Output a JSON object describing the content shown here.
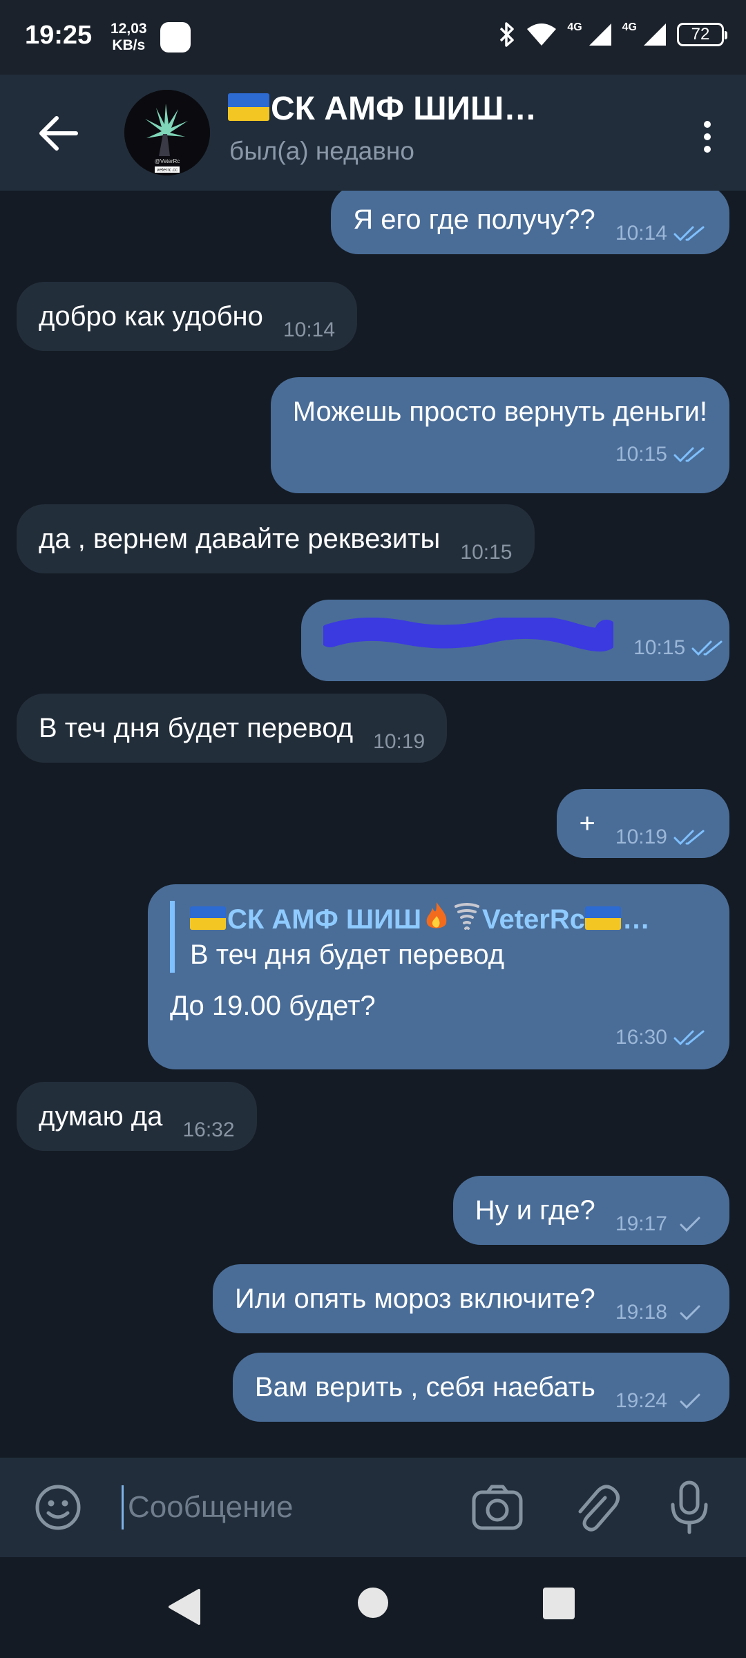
{
  "status_bar": {
    "time": "19:25",
    "speed_value": "12,03",
    "speed_unit": "KB/s",
    "network_1": "4G",
    "network_2": "4G",
    "battery": "72"
  },
  "header": {
    "title": "СК АМФ ШИШ…",
    "subtitle": "был(а) недавно",
    "avatar_caption_1": "@VeterRc",
    "avatar_caption_2": "veterrc.cc"
  },
  "messages": [
    {
      "dir": "out",
      "text": "Я его где получу??",
      "time": "10:14",
      "status": "read"
    },
    {
      "dir": "in",
      "text": "добро как удобно",
      "time": "10:14"
    },
    {
      "dir": "out",
      "text": "Можешь просто вернуть деньги!",
      "time": "10:15",
      "status": "read"
    },
    {
      "dir": "in",
      "text": "да  , вернем давайте реквезиты",
      "time": "10:15"
    },
    {
      "dir": "out",
      "text": "",
      "time": "10:15",
      "status": "read",
      "redacted": true
    },
    {
      "dir": "in",
      "text": "В теч дня будет перевод",
      "time": "10:19"
    },
    {
      "dir": "out",
      "text": "+",
      "time": "10:19",
      "status": "read"
    },
    {
      "dir": "out",
      "text": "До 19.00 будет?",
      "time": "16:30",
      "status": "read",
      "reply_name": "СК АМФ ШИШ",
      "reply_name_2": "VeterRc",
      "reply_text": "В теч дня будет перевод"
    },
    {
      "dir": "in",
      "text": "думаю да",
      "time": "16:32"
    },
    {
      "dir": "out",
      "text": "Ну и где?",
      "time": "19:17",
      "status": "sent"
    },
    {
      "dir": "out",
      "text": "Или опять мороз включите?",
      "time": "19:18",
      "status": "sent"
    },
    {
      "dir": "out",
      "text": "Вам верить , себя наебать",
      "time": "19:24",
      "status": "sent"
    }
  ],
  "input": {
    "placeholder": "Сообщение"
  },
  "icons": {
    "back": "arrow-left-icon",
    "menu": "more-vertical-icon",
    "emoji": "smile-icon",
    "camera": "camera-icon",
    "attach": "paperclip-icon",
    "mic": "microphone-icon"
  },
  "colors": {
    "background": "#141b24",
    "header": "#212d3b",
    "outgoing_bubble": "#4a6d98",
    "incoming_bubble": "#232e3b",
    "read_check": "#7fc0ff",
    "redaction": "#3a3ae0"
  }
}
